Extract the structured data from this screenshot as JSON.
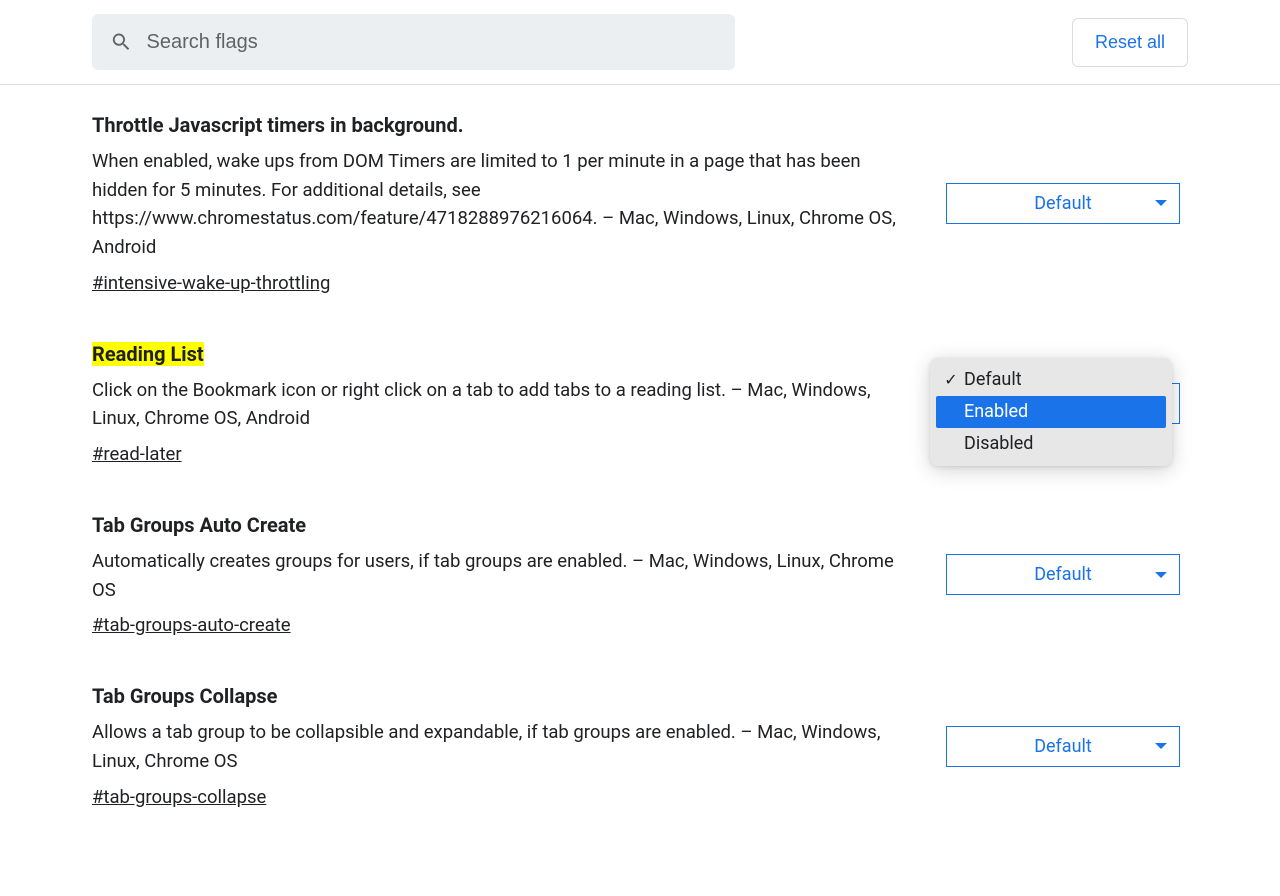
{
  "header": {
    "search_placeholder": "Search flags",
    "reset_label": "Reset all"
  },
  "flags": [
    {
      "title": "Throttle Javascript timers in background.",
      "description": "When enabled, wake ups from DOM Timers are limited to 1 per minute in a page that has been hidden for 5 minutes. For additional details, see https://www.chromestatus.com/feature/4718288976216064. – Mac, Windows, Linux, Chrome OS, Android",
      "anchor": "#intensive-wake-up-throttling",
      "selected": "Default",
      "highlighted": false,
      "dropdown_open": false
    },
    {
      "title": "Reading List",
      "description": "Click on the Bookmark icon or right click on a tab to add tabs to a reading list. – Mac, Windows, Linux, Chrome OS, Android",
      "anchor": "#read-later",
      "selected": "Default",
      "highlighted": true,
      "dropdown_open": true
    },
    {
      "title": "Tab Groups Auto Create",
      "description": "Automatically creates groups for users, if tab groups are enabled. – Mac, Windows, Linux, Chrome OS",
      "anchor": "#tab-groups-auto-create",
      "selected": "Default",
      "highlighted": false,
      "dropdown_open": false
    },
    {
      "title": "Tab Groups Collapse",
      "description": "Allows a tab group to be collapsible and expandable, if tab groups are enabled. – Mac, Windows, Linux, Chrome OS",
      "anchor": "#tab-groups-collapse",
      "selected": "Default",
      "highlighted": false,
      "dropdown_open": false
    }
  ],
  "dropdown": {
    "options": [
      "Default",
      "Enabled",
      "Disabled"
    ],
    "current_checked": "Default",
    "hovered": "Enabled"
  }
}
